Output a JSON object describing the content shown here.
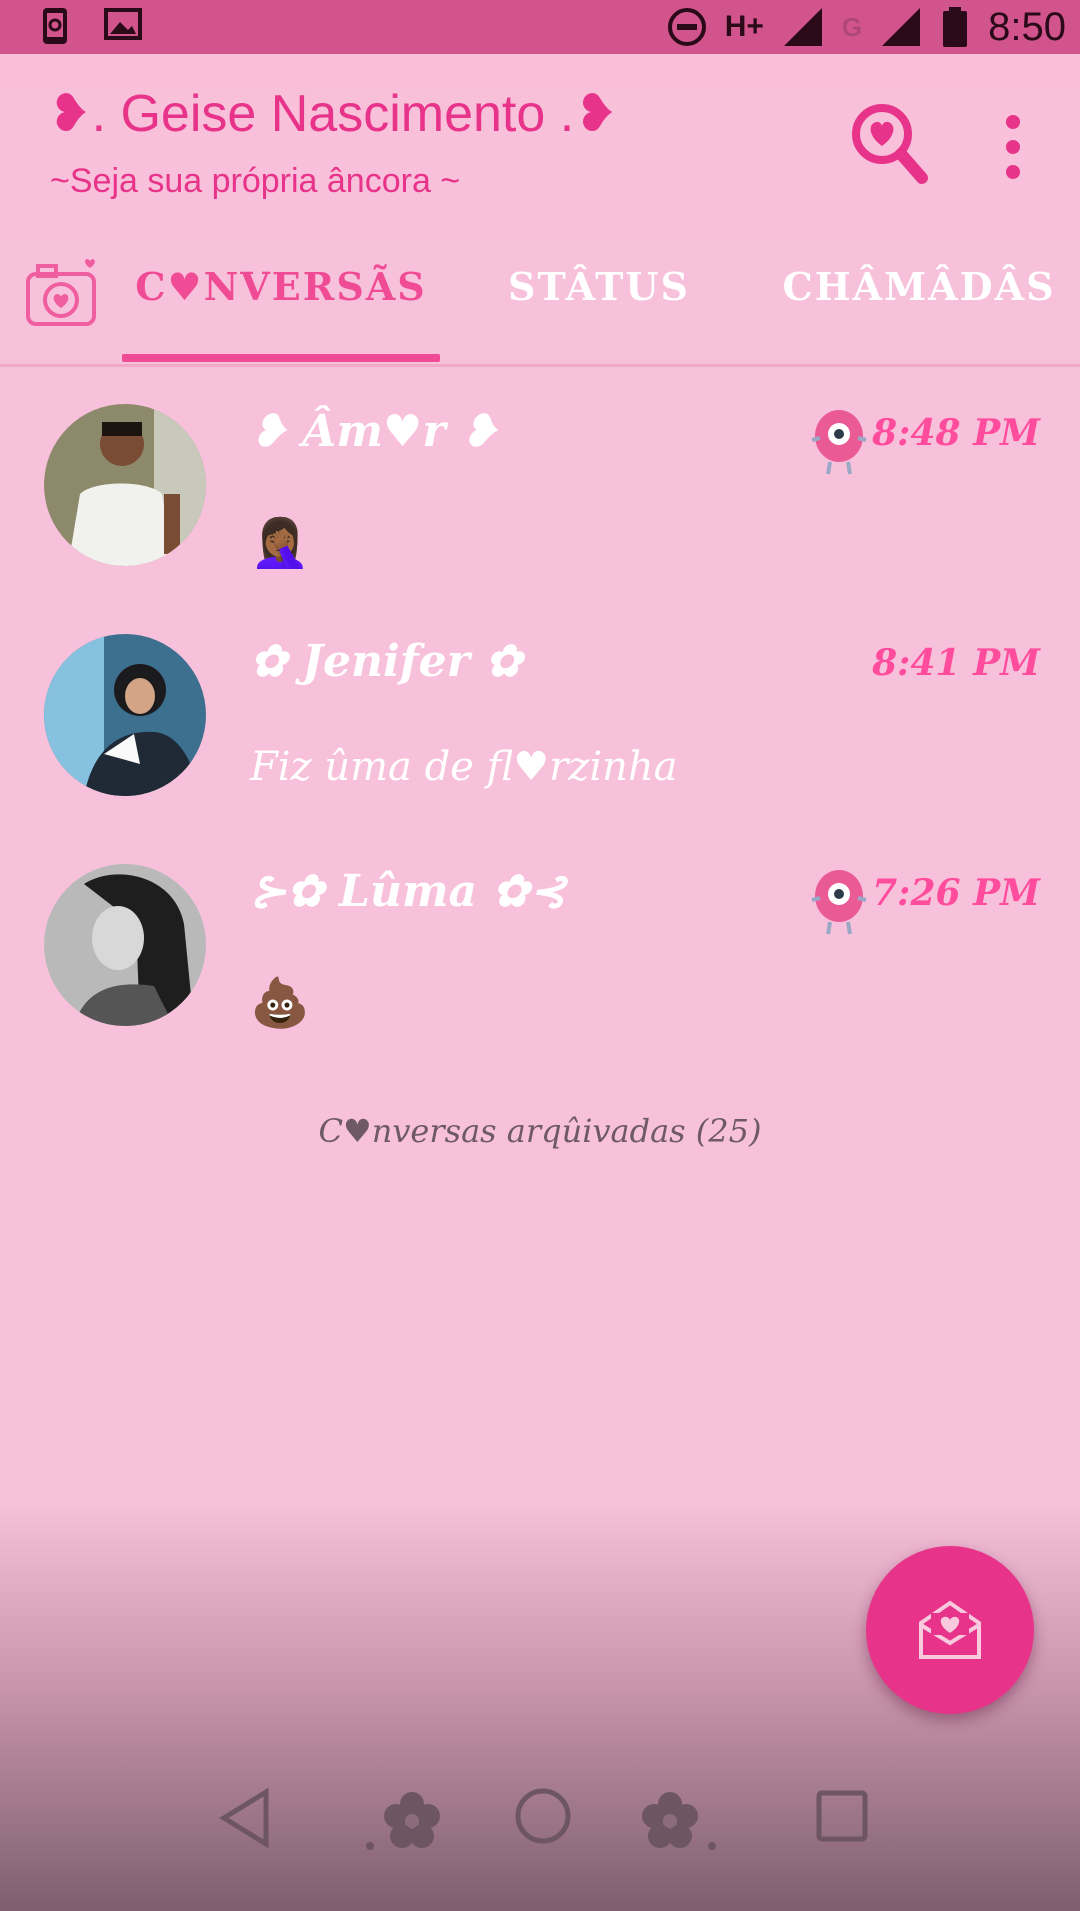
{
  "status_bar": {
    "network_label": "H+",
    "network2_label": "G",
    "time": "8:50"
  },
  "app_bar": {
    "title": "❥. Geise Nascimento .❥",
    "subtitle": "~Seja sua própria âncora ~",
    "icons": [
      "heart-search-icon",
      "more-vert-icon",
      "camera-heart-icon"
    ]
  },
  "tabs": [
    {
      "label": "C♥NVERSÃS",
      "active": true
    },
    {
      "label": "STÂTUS",
      "active": false
    },
    {
      "label": "CHÂMÂDÂS",
      "active": false
    }
  ],
  "chats": [
    {
      "name": "❥ Âm♥r ❥",
      "time": "8:48 PM",
      "message": "🤦🏾‍♀️",
      "has_monster_badge": true
    },
    {
      "name": "✿ Jenifer ✿",
      "time": "8:41 PM",
      "message": "Fiz ûma de fl♥rzinha",
      "has_monster_badge": false
    },
    {
      "name": "⊱✿ Lûma ✿⊰",
      "time": "7:26 PM",
      "message": "💩",
      "has_monster_badge": true
    }
  ],
  "archived_label": "C♥nversas arqûivadas (25)",
  "colors": {
    "accent": "#e8338a",
    "background": "#f8c1db",
    "status_bar": "#d2548d",
    "time_text": "#ff4c9c"
  }
}
